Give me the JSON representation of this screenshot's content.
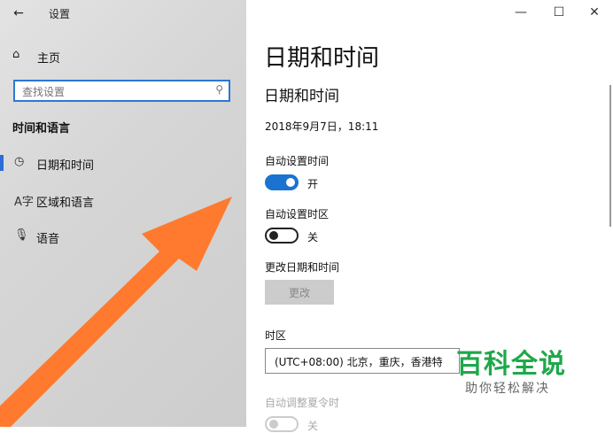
{
  "app": {
    "title": "设置"
  },
  "sidebar": {
    "home_label": "主页",
    "search_placeholder": "查找设置",
    "section_title": "时间和语言",
    "items": [
      {
        "label": "日期和时间",
        "icon": "calendar-clock-icon",
        "selected": true
      },
      {
        "label": "区域和语言",
        "icon": "language-icon",
        "selected": false
      },
      {
        "label": "语音",
        "icon": "microphone-icon",
        "selected": false
      }
    ]
  },
  "content": {
    "page_title": "日期和时间",
    "section_title": "日期和时间",
    "current_datetime": "2018年9月7日，18:11",
    "auto_time": {
      "label": "自动设置时间",
      "state": "开",
      "on": true
    },
    "auto_timezone": {
      "label": "自动设置时区",
      "state": "关",
      "on": false
    },
    "change_datetime": {
      "label": "更改日期和时间",
      "button": "更改"
    },
    "timezone": {
      "label": "时区",
      "value": "(UTC+08:00) 北京，重庆，香港特"
    },
    "dst": {
      "label": "自动调整夏令时",
      "state": "关"
    }
  },
  "watermark": {
    "main": "百科全说",
    "sub": "助你轻松解决"
  },
  "colors": {
    "accent": "#1a73d0",
    "arrow": "#ff7a2e",
    "watermark": "#1fa84b"
  }
}
